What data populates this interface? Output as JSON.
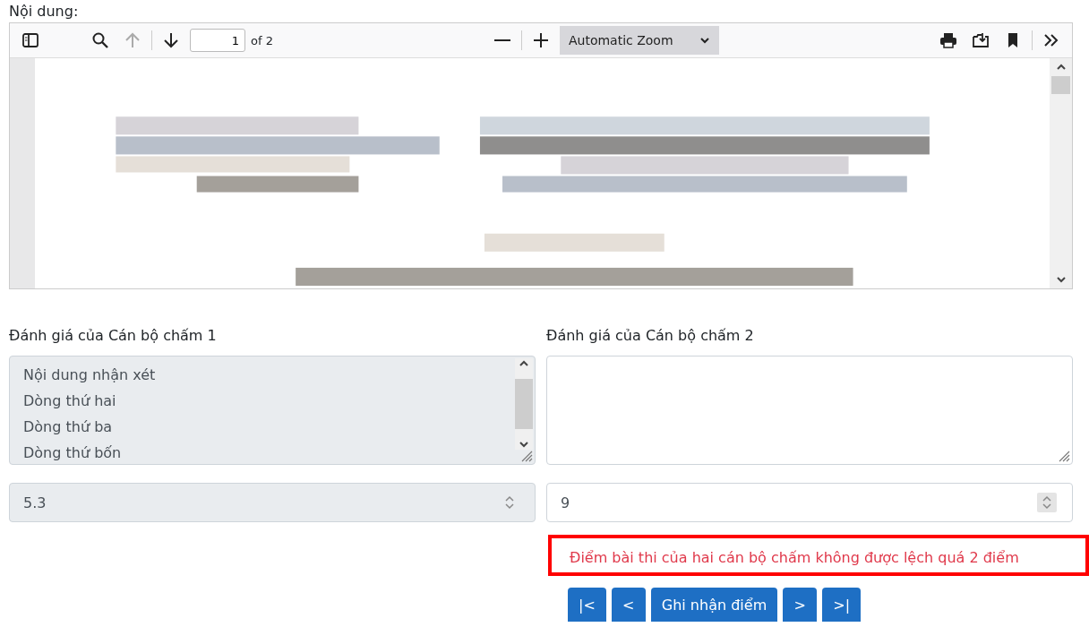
{
  "content_label": "Nội dung:",
  "viewer": {
    "toolbar_left": [
      {
        "kind": "sidebar",
        "disabled": false
      },
      {
        "kind": "search",
        "disabled": false
      },
      {
        "kind": "prev",
        "disabled": true
      },
      {
        "kind": "next",
        "disabled": false
      }
    ],
    "page_number": "1",
    "page_count": "of 2",
    "zoom": "Automatic Zoom",
    "toolbar_right": [
      {
        "kind": "print",
        "disabled": false
      },
      {
        "kind": "download",
        "disabled": false
      },
      {
        "kind": "bookmark",
        "disabled": false
      },
      {
        "kind": "more",
        "disabled": false
      }
    ]
  },
  "graders": [
    {
      "label": "Đánh giá của Cán bộ chấm 1",
      "comment_lines": [
        "Nội dung nhận xét",
        "Dòng thứ hai",
        "Dòng thứ ba",
        "Dòng thứ bốn"
      ],
      "score": "5.3",
      "disabled": true
    },
    {
      "label": "Đánh giá của Cán bộ chấm 2",
      "score": "9",
      "disabled": false
    }
  ],
  "error": "Điểm bài thi của hai cán bộ chấm không được lệch quá 2 điểm",
  "buttons": [
    {
      "label": "|<"
    },
    {
      "label": "<"
    },
    {
      "label": "Ghi nhận điểm"
    },
    {
      "label": ">"
    },
    {
      "label": ">|"
    }
  ]
}
